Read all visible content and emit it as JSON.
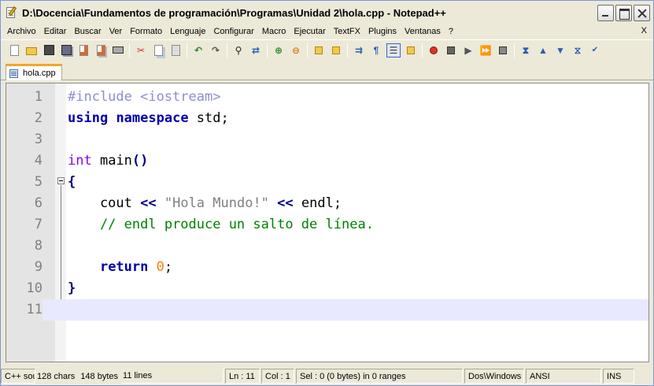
{
  "window": {
    "title": "D:\\Docencia\\Fundamentos de programación\\Programas\\Unidad 2\\hola.cpp - Notepad++"
  },
  "menu": {
    "items": [
      "Archivo",
      "Editar",
      "Buscar",
      "Ver",
      "Formato",
      "Lenguaje",
      "Configurar",
      "Macro",
      "Ejecutar",
      "TextFX",
      "Plugins",
      "Ventanas",
      "?"
    ],
    "close": "X"
  },
  "toolbar": {
    "icons": [
      "new-file-icon",
      "open-folder-icon",
      "save-icon",
      "save-all-icon",
      "close-file-icon",
      "close-all-icon",
      "print-icon",
      "cut-icon",
      "copy-icon",
      "paste-icon",
      "undo-icon",
      "redo-icon",
      "find-icon",
      "replace-icon",
      "zoom-in-icon",
      "zoom-out-icon",
      "sync-vertical-icon",
      "sync-horizontal-icon",
      "word-wrap-icon",
      "show-all-chars-icon",
      "indent-guide-icon",
      "doc-map-icon",
      "macro-record-icon",
      "macro-stop-icon",
      "macro-play-icon",
      "macro-run-multiple-icon",
      "macro-save-icon",
      "textfx-a-icon",
      "textfx-b-icon",
      "textfx-c-icon",
      "textfx-d-icon",
      "spellcheck-icon"
    ]
  },
  "tabs": [
    {
      "label": "hola.cpp"
    }
  ],
  "editor": {
    "lines": [
      {
        "n": "1",
        "segments": [
          {
            "cls": "pre",
            "t": "#include <iostream>"
          }
        ]
      },
      {
        "n": "2",
        "segments": [
          {
            "cls": "kw",
            "t": "using"
          },
          {
            "cls": "txt",
            "t": " "
          },
          {
            "cls": "kw",
            "t": "namespace"
          },
          {
            "cls": "txt",
            "t": " std;"
          }
        ]
      },
      {
        "n": "3",
        "segments": []
      },
      {
        "n": "4",
        "segments": [
          {
            "cls": "typ",
            "t": "int"
          },
          {
            "cls": "txt",
            "t": " main"
          },
          {
            "cls": "op",
            "t": "()"
          }
        ]
      },
      {
        "n": "5",
        "segments": [
          {
            "cls": "op",
            "t": "{"
          }
        ]
      },
      {
        "n": "6",
        "segments": [
          {
            "cls": "txt",
            "t": "    cout "
          },
          {
            "cls": "op",
            "t": "<<"
          },
          {
            "cls": "txt",
            "t": " "
          },
          {
            "cls": "str",
            "t": "\"Hola Mundo!\""
          },
          {
            "cls": "txt",
            "t": " "
          },
          {
            "cls": "op",
            "t": "<<"
          },
          {
            "cls": "txt",
            "t": " endl;"
          }
        ]
      },
      {
        "n": "7",
        "segments": [
          {
            "cls": "cmt",
            "t": "    // endl produce un salto de línea."
          }
        ]
      },
      {
        "n": "8",
        "segments": []
      },
      {
        "n": "9",
        "segments": [
          {
            "cls": "txt",
            "t": "    "
          },
          {
            "cls": "kw",
            "t": "return"
          },
          {
            "cls": "txt",
            "t": " "
          },
          {
            "cls": "num",
            "t": "0"
          },
          {
            "cls": "txt",
            "t": ";"
          }
        ]
      },
      {
        "n": "10",
        "segments": [
          {
            "cls": "op",
            "t": "}"
          }
        ]
      },
      {
        "n": "11",
        "segments": [],
        "current": true
      }
    ]
  },
  "status": {
    "lang": "C++ sou",
    "chars": "128 chars",
    "bytes": "148 bytes",
    "lines": "11 lines",
    "ln": "Ln : 11",
    "col": "Col : 1",
    "sel": "Sel : 0 (0 bytes) in 0 ranges",
    "eol": "Dos\\Windows",
    "encoding": "ANSI",
    "mode": "INS"
  }
}
